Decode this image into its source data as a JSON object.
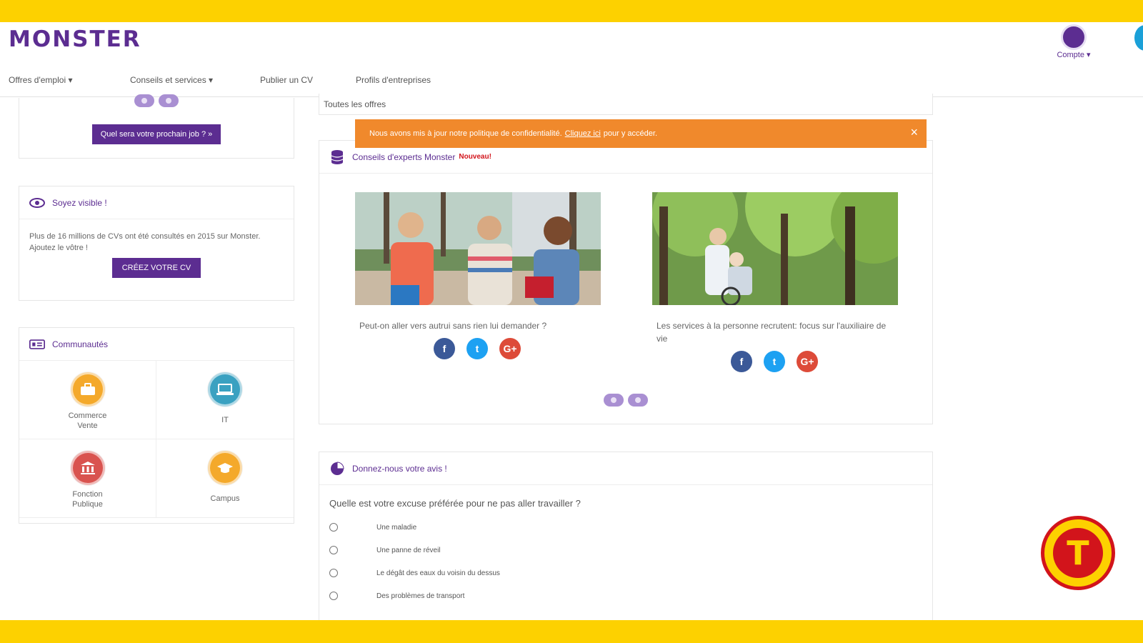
{
  "brand": {
    "logo_text": "MONSTER",
    "accent": "#5c2d91",
    "band_color": "#fdd100",
    "alert_color": "#f0892c"
  },
  "header": {
    "account_label": "Compte ▾",
    "nav": [
      "Offres d'emploi ▾",
      "Conseils et services ▾",
      "Publier un CV",
      "Profils d'entreprises"
    ]
  },
  "breadcrumb": "Toutes les offres",
  "sidebar": {
    "job_button": "Quel sera votre prochain job ? »",
    "visible": {
      "title": "Soyez visible !",
      "text": "Plus de 16 millions de CVs ont été consultés en 2015 sur Monster. Ajoutez le vôtre !",
      "button": "CRÉEZ VOTRE CV"
    },
    "communities": {
      "title": "Communautés",
      "items": [
        {
          "label": "Commerce Vente",
          "color": "#f4a92b",
          "icon": "briefcase-icon"
        },
        {
          "label": "IT",
          "color": "#3aa1c1",
          "icon": "laptop-icon"
        },
        {
          "label": "Fonction Publique",
          "color": "#d9534f",
          "icon": "building-icon"
        },
        {
          "label": "Campus",
          "color": "#f4a92b",
          "icon": "graduation-cap-icon"
        }
      ]
    }
  },
  "alert": {
    "text_before": "Nous avons mis à jour notre politique de confidentialité.",
    "link": "Cliquez ici",
    "text_after": "pour y accéder.",
    "close": "×"
  },
  "experts": {
    "title": "Conseils d'experts Monster",
    "badge": "Nouveau!",
    "articles": [
      {
        "title": "Peut-on aller vers autrui sans rien lui demander ?"
      },
      {
        "title": "Les services à la personne recrutent: focus sur l'auxiliaire de vie"
      }
    ]
  },
  "poll": {
    "title": "Donnez-nous votre avis !",
    "question": "Quelle est votre excuse préférée pour ne pas aller travailler ?",
    "options": [
      "Une maladie",
      "Une panne de réveil",
      "Le dégât des eaux du voisin du dessus",
      "Des problèmes de transport"
    ]
  },
  "social": {
    "facebook": "f",
    "twitter": "t",
    "google": "G+"
  },
  "badge_letter": "T"
}
